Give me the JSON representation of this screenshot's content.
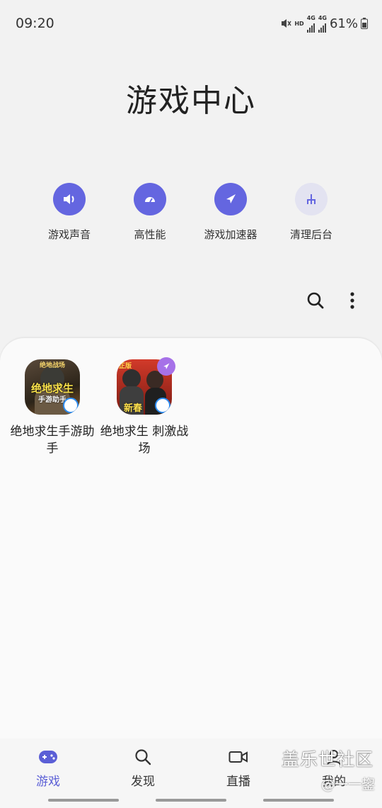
{
  "status_bar": {
    "time": "09:20",
    "hd_label": "HD",
    "network_1": "4G",
    "network_2": "4G",
    "battery": "61%"
  },
  "header": {
    "title": "游戏中心"
  },
  "quick_actions": [
    {
      "label": "游戏声音",
      "icon": "speaker-icon"
    },
    {
      "label": "高性能",
      "icon": "speedometer-icon"
    },
    {
      "label": "游戏加速器",
      "icon": "rocket-icon"
    },
    {
      "label": "清理后台",
      "icon": "broom-icon"
    }
  ],
  "toolbar": {
    "search_icon": "search-icon",
    "more_icon": "more-vertical-icon"
  },
  "games": [
    {
      "name": "绝地求生手游助手",
      "icon_text_top": "绝地战场",
      "icon_text_main": "绝地求生",
      "icon_text_sub": "手游助手"
    },
    {
      "name": "绝地求生 刺激战场",
      "icon_text_top": "正版",
      "icon_text_sub": "新春"
    }
  ],
  "bottom_nav": [
    {
      "label": "游戏",
      "icon": "gamepad-icon",
      "active": true
    },
    {
      "label": "发现",
      "icon": "search-icon",
      "active": false
    },
    {
      "label": "直播",
      "icon": "video-camera-icon",
      "active": false
    },
    {
      "label": "我的",
      "icon": "person-icon",
      "active": false
    }
  ],
  "watermark": {
    "line1": "盖乐世社区",
    "line2": "@一一鋆"
  },
  "colors": {
    "accent": "#6466e0",
    "accent_light": "#e3e3f1",
    "background": "#f2f2f2",
    "panel": "#fafafa"
  }
}
